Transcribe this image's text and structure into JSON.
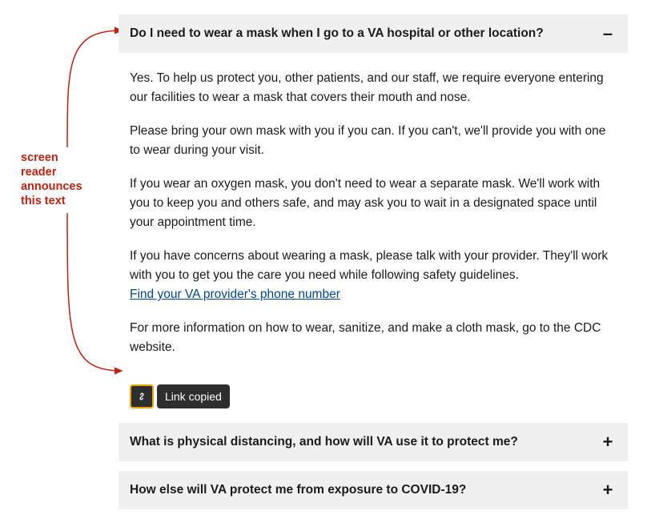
{
  "annotation": "screen reader announces this text",
  "accordion": {
    "expanded": {
      "title": "Do I need to wear a mask when I go to a VA hospital or other location?",
      "p1": "Yes. To help us protect you, other patients, and our staff, we require everyone entering our facilities to wear a mask that covers their mouth and nose.",
      "p2": "Please bring your own mask with you if you can. If you can't, we'll provide you with one to wear during your visit.",
      "p3": "If you wear an oxygen mask, you don't need to wear a separate mask. We'll work with you to keep you and others safe, and may ask you to wait in a designated space until your appointment time.",
      "p4": "If you have concerns about wearing a mask, please talk with your provider. They'll work with you to get you the care you need while following safety guidelines.",
      "link": "Find your VA provider's phone number",
      "p5": "For more information on how to wear, sanitize, and make a cloth mask, go to the CDC website."
    },
    "copied_label": "Link copied",
    "collapsed1": "What is physical distancing, and how will VA use it to protect me?",
    "collapsed2": "How else will VA protect me from exposure to COVID-19?"
  },
  "icons": {
    "minus": "–",
    "plus": "+"
  }
}
